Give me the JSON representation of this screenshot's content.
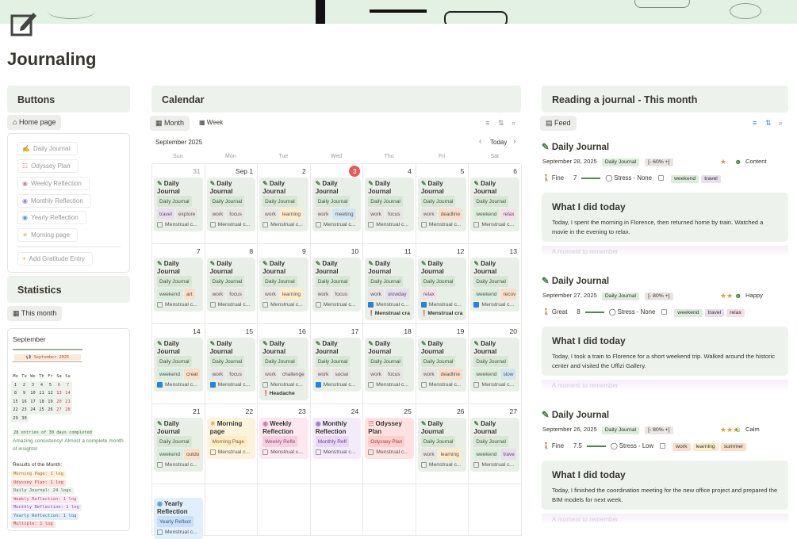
{
  "page": {
    "title": "Journaling"
  },
  "buttons": {
    "heading": "Buttons",
    "home": "Home page",
    "items": [
      {
        "icon": "✍",
        "label": "Daily Journal",
        "color": "#9ab09a"
      },
      {
        "icon": "☷",
        "label": "Odyssey Plan",
        "color": "#e08080"
      },
      {
        "icon": "◉",
        "label": "Weekly Reflection",
        "color": "#d07fa0"
      },
      {
        "icon": "◉",
        "label": "Monthly Reflection",
        "color": "#9a7fd0"
      },
      {
        "icon": "◉",
        "label": "Yearly Reflection",
        "color": "#5a9ad0"
      },
      {
        "icon": "☀",
        "label": "Morning page",
        "color": "#e0a050"
      },
      {
        "icon": "+",
        "label": "Add Gratitude Entry",
        "color": "#e0a050"
      }
    ]
  },
  "stats": {
    "heading": "Statistics",
    "tab": "This month",
    "month_label": "September",
    "mini_title": "📢 September 2025",
    "weekdays": [
      "Mo",
      "Tu",
      "We",
      "Th",
      "Fr",
      "Sa",
      "Su"
    ],
    "mini_rows": [
      [
        "1",
        "2",
        "3",
        "4",
        "5",
        "6",
        "7"
      ],
      [
        "8",
        "9",
        "10",
        "11",
        "12",
        "13",
        "14"
      ],
      [
        "15",
        "16",
        "17",
        "18",
        "19",
        "20",
        "21"
      ],
      [
        "22",
        "23",
        "24",
        "25",
        "26",
        "27",
        "28"
      ],
      [
        "29",
        "30",
        "",
        "",
        "",
        "",
        ""
      ]
    ],
    "entries": "28 entries of 30 days completed",
    "note": "Amazing consistency! Almost a complete month of insights!",
    "results_title": "Results of the Month:",
    "results": [
      {
        "text": "Morning Page: 1 log",
        "bg": "#fbf3db",
        "fg": "#a07030"
      },
      {
        "text": "Odyssey Plan: 1 log",
        "bg": "#fde2e1",
        "fg": "#c04040"
      },
      {
        "text": "Daily Journal: 24 logs",
        "bg": "#edf3ec",
        "fg": "#507050"
      },
      {
        "text": "Weekly Reflection: 1 log",
        "bg": "#fbe8f0",
        "fg": "#b05080"
      },
      {
        "text": "Monthly Reflection: 1 log",
        "bg": "#f3ebfa",
        "fg": "#8050b0"
      },
      {
        "text": "Yearly Reflection: 1 log",
        "bg": "#e1effa",
        "fg": "#3070a0"
      },
      {
        "text": "Multiple: 1 log",
        "bg": "#fde2e1",
        "fg": "#c04040"
      }
    ]
  },
  "calendar": {
    "heading": "Calendar",
    "view_month": "Month",
    "view_week": "Week",
    "month_title": "September 2025",
    "today_label": "Today",
    "weekdays": [
      "Sun",
      "Mon",
      "Tue",
      "Wed",
      "Thu",
      "Fri",
      "Sat"
    ],
    "weeks": [
      [
        {
          "d": "31",
          "muted": true
        },
        {
          "d": "Sep 1"
        },
        {
          "d": "2"
        },
        {
          "d": "3",
          "today": true
        },
        {
          "d": "4"
        },
        {
          "d": "5"
        },
        {
          "d": "6"
        }
      ],
      [
        {
          "d": "7"
        },
        {
          "d": "8"
        },
        {
          "d": "9"
        },
        {
          "d": "10"
        },
        {
          "d": "11"
        },
        {
          "d": "12"
        },
        {
          "d": "13"
        }
      ],
      [
        {
          "d": "14"
        },
        {
          "d": "15"
        },
        {
          "d": "16"
        },
        {
          "d": "17"
        },
        {
          "d": "18"
        },
        {
          "d": "19"
        },
        {
          "d": "20"
        }
      ],
      [
        {
          "d": "21"
        },
        {
          "d": "22"
        },
        {
          "d": "23"
        },
        {
          "d": "24"
        },
        {
          "d": "25"
        },
        {
          "d": "26"
        },
        {
          "d": "27"
        }
      ],
      [
        {
          "d": ""
        },
        {
          "d": ""
        },
        {
          "d": ""
        },
        {
          "d": ""
        },
        {
          "d": ""
        },
        {
          "d": ""
        },
        {
          "d": ""
        }
      ]
    ],
    "cards": [
      {
        "w": 0,
        "c": 0,
        "title": "Daily Journal",
        "tags": [
          "travel",
          "explore"
        ],
        "cb": false
      },
      {
        "w": 0,
        "c": 1,
        "title": "Daily Journal",
        "tags": [
          "work",
          "focus"
        ],
        "cb": false
      },
      {
        "w": 0,
        "c": 2,
        "title": "Daily Journal",
        "tags": [
          "work",
          "learning"
        ],
        "cb": false
      },
      {
        "w": 0,
        "c": 3,
        "title": "Daily Journal",
        "tags": [
          "work",
          "meeting"
        ],
        "cb": false
      },
      {
        "w": 0,
        "c": 4,
        "title": "Daily Journal",
        "tags": [
          "work",
          "focus"
        ],
        "cb": false
      },
      {
        "w": 0,
        "c": 5,
        "title": "Daily Journal",
        "tags": [
          "work",
          "deadline"
        ],
        "cb": false
      },
      {
        "w": 0,
        "c": 6,
        "title": "Daily Journal",
        "tags": [
          "weekend",
          "relax"
        ],
        "cb": false
      },
      {
        "w": 1,
        "c": 0,
        "title": "Daily Journal",
        "tags": [
          "weekend",
          "art"
        ],
        "cb": false
      },
      {
        "w": 1,
        "c": 1,
        "title": "Daily Journal",
        "tags": [
          "work",
          "focus"
        ],
        "cb": false
      },
      {
        "w": 1,
        "c": 2,
        "title": "Daily Journal",
        "tags": [
          "work",
          "learning"
        ],
        "cb": false
      },
      {
        "w": 1,
        "c": 3,
        "title": "Daily Journal",
        "tags": [
          "work",
          "focus"
        ],
        "cb": false
      },
      {
        "w": 1,
        "c": 4,
        "title": "Daily Journal",
        "tags": [
          "work",
          "slowday"
        ],
        "cb": true,
        "alert": "Menstrual cra"
      },
      {
        "w": 1,
        "c": 5,
        "title": "Daily Journal",
        "tags": [
          "relax"
        ],
        "cb": true,
        "alert": "Menstrual cra"
      },
      {
        "w": 1,
        "c": 6,
        "title": "Daily Journal",
        "tags": [
          "weekend",
          "recov"
        ],
        "cb": true
      },
      {
        "w": 2,
        "c": 0,
        "title": "Daily Journal",
        "tags": [
          "weekend",
          "creat"
        ],
        "cb": true
      },
      {
        "w": 2,
        "c": 1,
        "title": "Daily Journal",
        "tags": [
          "work",
          "focus"
        ],
        "cb": true
      },
      {
        "w": 2,
        "c": 2,
        "title": "Daily Journal",
        "tags": [
          "work",
          "challenge"
        ],
        "cb": false,
        "alert": "Headache"
      },
      {
        "w": 2,
        "c": 3,
        "title": "Daily Journal",
        "tags": [
          "work",
          "social"
        ],
        "cb": true
      },
      {
        "w": 2,
        "c": 4,
        "title": "Daily Journal",
        "tags": [
          "work",
          "focus"
        ],
        "cb": false
      },
      {
        "w": 2,
        "c": 5,
        "title": "Daily Journal",
        "tags": [
          "work",
          "deadline"
        ],
        "cb": false
      },
      {
        "w": 2,
        "c": 6,
        "title": "Daily Journal",
        "tags": [
          "weekend",
          "slow"
        ],
        "cb": false
      },
      {
        "w": 3,
        "c": 0,
        "title": "Daily Journal",
        "tags": [
          "weekend",
          "outdo"
        ],
        "cb": false
      },
      {
        "w": 3,
        "c": 1,
        "title": "Morning page",
        "kind": "morning",
        "pill": "Morning Page",
        "cb": false
      },
      {
        "w": 3,
        "c": 2,
        "title": "Weekly Reflection",
        "kind": "weekly",
        "pill": "Weekly Refle",
        "cb": false
      },
      {
        "w": 3,
        "c": 3,
        "title": "Monthly Reflection",
        "kind": "monthly",
        "pill": "Monthly Refl",
        "cb": false
      },
      {
        "w": 3,
        "c": 4,
        "title": "Odyssey Plan",
        "kind": "odyssey",
        "pill": "Odyssey Plan",
        "cb": false
      },
      {
        "w": 3,
        "c": 5,
        "title": "Daily Journal",
        "tags": [
          "work",
          "learning"
        ],
        "cb": false
      },
      {
        "w": 3,
        "c": 6,
        "title": "Daily Journal",
        "tags": [
          "weekend",
          "trave"
        ],
        "cb": false
      },
      {
        "w": 4,
        "c": 0,
        "title": "Yearly Reflection",
        "kind": "yearly",
        "pill": "Yearly Reflect",
        "cb": false
      }
    ],
    "db_pill": "Daily Journal",
    "menstrual": "Menstrual c..."
  },
  "feed": {
    "heading": "Reading a journal - This month",
    "tab": "Feed",
    "entries": [
      {
        "title": "Daily Journal",
        "date": "September 28, 2025",
        "db": "Daily Journal",
        "progress": "[- 60% +]",
        "pct": 60,
        "stars": "★",
        "mood_icon": "☻",
        "mood": "Content",
        "mood_bg": "#fff",
        "energy": "Fine",
        "energy_val": "7",
        "stress": "Stress - None",
        "tags": [
          {
            "t": "weekend",
            "bg": "#dbeddb"
          },
          {
            "t": "travel",
            "bg": "#e8deee"
          }
        ],
        "body_title": "What I did today",
        "body": "Today, I spent the morning in Florence, then returned home by train. Watched a movie in the evening to relax.",
        "fade": "A moment to remember"
      },
      {
        "title": "Daily Journal",
        "date": "September 27, 2025",
        "db": "Daily Journal",
        "progress": "[- 80% +]",
        "pct": 80,
        "stars": "★★",
        "mood_icon": "☻",
        "mood": "Happy",
        "energy": "Great",
        "energy_val": "8",
        "stress": "Stress - None",
        "tags": [
          {
            "t": "weekend",
            "bg": "#dbeddb"
          },
          {
            "t": "travel",
            "bg": "#e8deee"
          },
          {
            "t": "relax",
            "bg": "#f5e0e9"
          }
        ],
        "body_title": "What I did today",
        "body": "Today, I took a train to Florence for a short weekend trip. Walked around the historic center and visited the Uffizi Gallery.",
        "fade": "A moment to remember"
      },
      {
        "title": "Daily Journal",
        "date": "September 26, 2025",
        "db": "Daily Journal",
        "progress": "[- 80% +]",
        "pct": 80,
        "stars": "★★★",
        "mood_icon": "☺",
        "mood": "Calm",
        "energy": "Fine",
        "energy_val": "7.5",
        "stress": "Stress - Low",
        "tags": [
          {
            "t": "work",
            "bg": "#fadec9"
          },
          {
            "t": "learning",
            "bg": "#fdecc8"
          },
          {
            "t": "summer",
            "bg": "#fadec9"
          }
        ],
        "body_title": "What I did today",
        "body": "Today, I finished the coordination meeting for the new office project and prepared the BIM models for next week.",
        "fade": "A moment to remember"
      }
    ]
  },
  "colors": {
    "green_bg": "#edf3ec",
    "accent_red": "#eb5757",
    "check_blue": "#2383e2"
  }
}
